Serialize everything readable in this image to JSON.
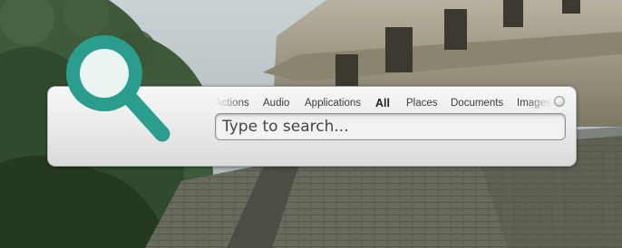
{
  "wallpaper": {
    "icon": "palenque-temple-photo"
  },
  "launcher": {
    "icon": "search-magnifier-icon",
    "accent_color": "#2a9d8f",
    "categories": [
      {
        "label": "Actions",
        "active": false
      },
      {
        "label": "Audio",
        "active": false
      },
      {
        "label": "Applications",
        "active": false
      },
      {
        "label": "All",
        "active": true
      },
      {
        "label": "Places",
        "active": false
      },
      {
        "label": "Documents",
        "active": false
      },
      {
        "label": "Images",
        "active": false
      }
    ],
    "search": {
      "value": "",
      "placeholder": "Type to search..."
    },
    "status_icon": "busy-indicator-icon"
  }
}
